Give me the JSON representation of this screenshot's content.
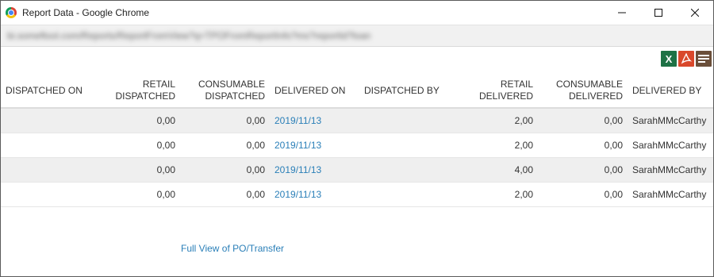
{
  "window": {
    "title": "Report Data - Google Chrome",
    "url": "bi.someftool.com/Reports/ReportFromView?q=TPOFromReportInfo?ms?reportId?loan"
  },
  "toolbar": {
    "excel_label": "X"
  },
  "table": {
    "headers": {
      "dispatched_on": "DISPATCHED ON",
      "retail_dispatched": "RETAIL DISPATCHED",
      "consumable_dispatched": "CONSUMABLE DISPATCHED",
      "delivered_on": "DELIVERED ON",
      "dispatched_by": "DISPATCHED BY",
      "retail_delivered": "RETAIL DELIVERED",
      "consumable_delivered": "CONSUMABLE DELIVERED",
      "delivered_by": "DELIVERED BY"
    },
    "rows": [
      {
        "dispatched_on": "",
        "retail_dispatched": "0,00",
        "consumable_dispatched": "0,00",
        "delivered_on": "2019/11/13",
        "dispatched_by": "",
        "retail_delivered": "2,00",
        "consumable_delivered": "0,00",
        "delivered_by": "SarahMMcCarthy"
      },
      {
        "dispatched_on": "",
        "retail_dispatched": "0,00",
        "consumable_dispatched": "0,00",
        "delivered_on": "2019/11/13",
        "dispatched_by": "",
        "retail_delivered": "2,00",
        "consumable_delivered": "0,00",
        "delivered_by": "SarahMMcCarthy"
      },
      {
        "dispatched_on": "",
        "retail_dispatched": "0,00",
        "consumable_dispatched": "0,00",
        "delivered_on": "2019/11/13",
        "dispatched_by": "",
        "retail_delivered": "4,00",
        "consumable_delivered": "0,00",
        "delivered_by": "SarahMMcCarthy"
      },
      {
        "dispatched_on": "",
        "retail_dispatched": "0,00",
        "consumable_dispatched": "0,00",
        "delivered_on": "2019/11/13",
        "dispatched_by": "",
        "retail_delivered": "2,00",
        "consumable_delivered": "0,00",
        "delivered_by": "SarahMMcCarthy"
      }
    ]
  },
  "footer": {
    "full_view_link": "Full View of PO/Transfer"
  },
  "colors": {
    "link": "#2a7fb8",
    "excel": "#1e7145",
    "pdf": "#d9482b",
    "list": "#6b4f3a",
    "stripe": "#efefef"
  }
}
